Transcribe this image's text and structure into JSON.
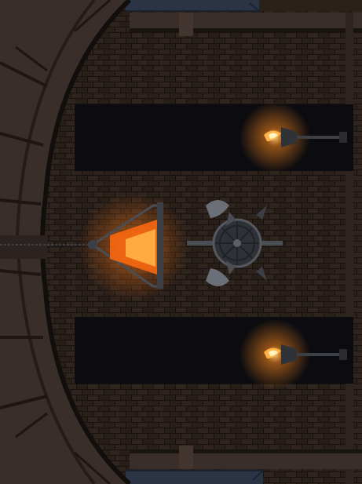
{
  "scene": {
    "name": "dungeon-hall",
    "orientation": "rotated-90",
    "palette": {
      "brick_base": "#2b211b",
      "brick_mortar": "#171210",
      "arch_stone": "#3a2e2a",
      "arch_outline": "#120e0d",
      "window_dark": "#0c0c10",
      "top_blue_stone": "#2a3444",
      "torch_flame": "#ffb347",
      "torch_glow": "#ff8a1e",
      "brazier_fire": "#ff6a10",
      "metal": "#3c4046"
    },
    "objects": [
      {
        "name": "left-stone-arch",
        "icon": "arch-icon"
      },
      {
        "name": "upper-dark-window",
        "icon": "window-icon"
      },
      {
        "name": "lower-dark-window",
        "icon": "window-icon"
      },
      {
        "name": "upper-wall-torch",
        "icon": "torch-icon",
        "lit": true
      },
      {
        "name": "lower-wall-torch",
        "icon": "torch-icon",
        "lit": true
      },
      {
        "name": "hanging-brazier",
        "icon": "brazier-icon",
        "lit": true
      },
      {
        "name": "axe-shield-emblem",
        "icon": "shield-axes-icon"
      }
    ]
  }
}
